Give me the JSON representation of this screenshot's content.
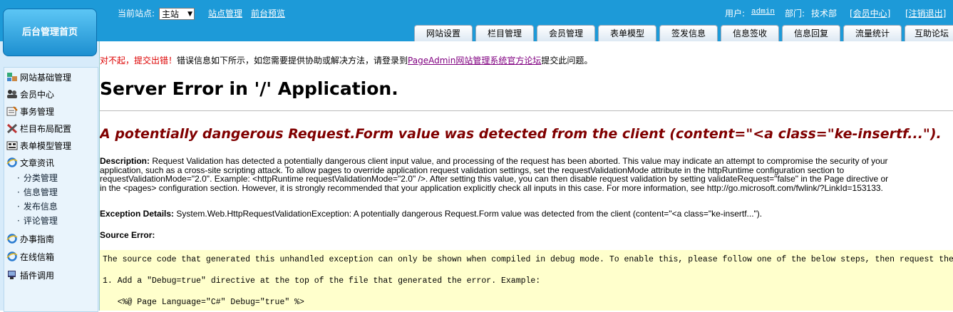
{
  "header": {
    "logo_label": "后台管理首页",
    "site_label": "当前站点:",
    "site_value": "主站",
    "site_links": [
      "站点管理",
      "前台预览"
    ],
    "user_label": "用户:",
    "user_name": "admin",
    "dept_label": "部门:",
    "dept_name": "技术部",
    "member_center": "[会员中心]",
    "logout": "[注销退出]",
    "tabs": [
      "网站设置",
      "栏目管理",
      "会员管理",
      "表单模型",
      "签发信息",
      "信息签收",
      "信息回复",
      "流量统计",
      "互助论坛"
    ]
  },
  "sidebar": {
    "items": [
      {
        "label": "网站基础管理",
        "icon": "site-icon"
      },
      {
        "label": "会员中心",
        "icon": "members-icon"
      },
      {
        "label": "事务管理",
        "icon": "affairs-icon"
      },
      {
        "label": "栏目布局配置",
        "icon": "tools-icon"
      },
      {
        "label": "表单模型管理",
        "icon": "form-icon"
      },
      {
        "label": "文章资讯",
        "icon": "ie-icon"
      }
    ],
    "subitems": [
      "分类管理",
      "信息管理",
      "发布信息",
      "评论管理"
    ],
    "items2": [
      {
        "label": "办事指南",
        "icon": "ie-icon"
      },
      {
        "label": "在线信箱",
        "icon": "ie-icon"
      },
      {
        "label": "插件调用",
        "icon": "plugin-icon"
      }
    ]
  },
  "content": {
    "notice_red": "对不起，提交出错！",
    "notice_text": "错误信息如下所示，如您需要提供协助或解决方法，请登录到",
    "notice_link": "PageAdmin网站管理系统官方论坛",
    "notice_tail": "提交此问题。",
    "h1": "Server Error in '/' Application.",
    "h2": "A potentially dangerous Request.Form value was detected from the client (content=\"<a class=\"ke-insertf...\").",
    "desc_label": "Description:",
    "desc_lines": [
      " Request Validation has detected a potentially dangerous client input value, and processing of the request has been aborted. This value may indicate an attempt to compromise the security of your",
      "application, such as a cross-site scripting attack. To allow pages to override application request validation settings, set the requestValidationMode attribute in the httpRuntime configuration section to",
      "requestValidationMode=\"2.0\". Example: <httpRuntime requestValidationMode=\"2.0\" />. After setting this value, you can then disable request validation by setting validateRequest=\"false\" in the Page directive or",
      "in the <pages> configuration section. However, it is strongly recommended that your application explicitly check all inputs in this case. For more information, see http://go.microsoft.com/fwlink/?LinkId=153133."
    ],
    "exc_label": "Exception Details:",
    "exc_text": " System.Web.HttpRequestValidationException: A potentially dangerous Request.Form value was detected from the client (content=\"<a class=\"ke-insertf...\").",
    "src_label": "Source Error:",
    "code_lines": [
      "The source code that generated this unhandled exception can only be shown when compiled in debug mode. To enable this, please follow one of the below steps, then request the URL:",
      "1. Add a \"Debug=true\" directive at the top of the file that generated the error. Example:",
      "   <%@ Page Language=\"C#\" Debug=\"true\" %>"
    ]
  }
}
